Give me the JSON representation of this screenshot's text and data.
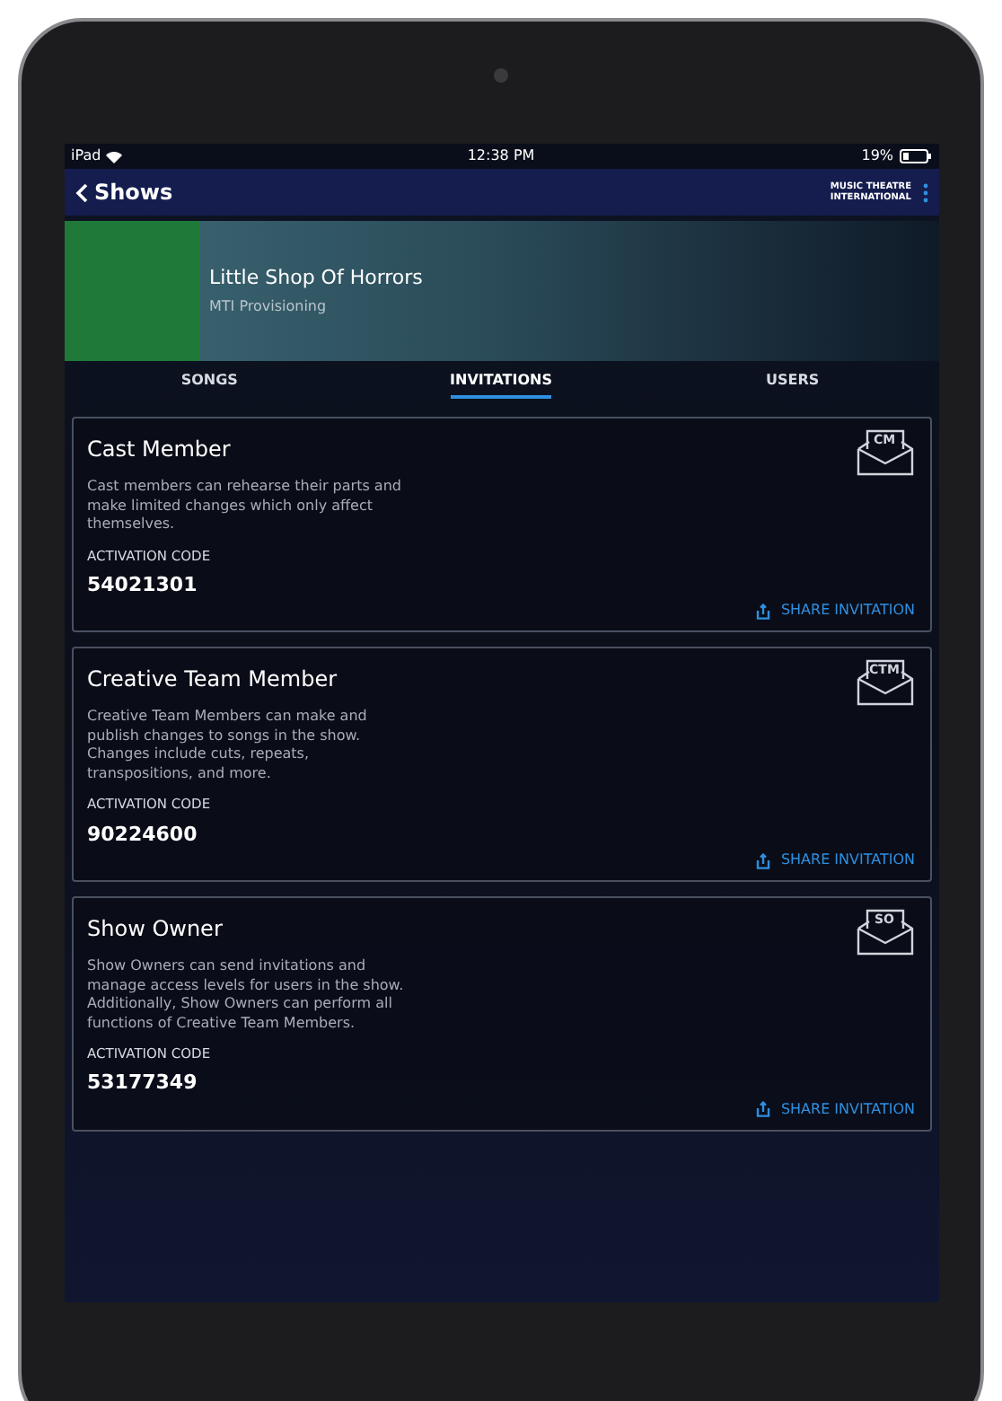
{
  "status_bar": {
    "device": "iPad",
    "time": "12:38 PM",
    "battery": "19%"
  },
  "nav": {
    "back": "Shows",
    "brand_line1": "MUSIC THEATRE",
    "brand_line2": "INTERNATIONAL"
  },
  "show": {
    "title": "Little Shop Of Horrors",
    "subtitle": "MTI Provisioning"
  },
  "tabs": [
    {
      "label": "SONGS",
      "selected": false
    },
    {
      "label": "INVITATIONS",
      "selected": true
    },
    {
      "label": "USERS",
      "selected": false
    }
  ],
  "invitations": [
    {
      "title": "Cast Member",
      "badge": "CM",
      "description": "Cast members can rehearse their parts and make limited changes which only affect themselves.",
      "code_label": "ACTIVATION CODE",
      "code": "54021301",
      "share": "SHARE INVITATION"
    },
    {
      "title": "Creative Team Member",
      "badge": "CTM",
      "description": "Creative Team Members can make and publish changes to songs in the show. Changes include cuts, repeats, transpositions, and more.",
      "code_label": "ACTIVATION CODE",
      "code": "90224600",
      "share": "SHARE INVITATION"
    },
    {
      "title": "Show Owner",
      "badge": "SO",
      "description": "Show Owners can send invitations and manage access levels for users in the show. Additionally, Show Owners can perform all functions of Creative Team Members.",
      "code_label": "ACTIVATION CODE",
      "code": "53177349",
      "share": "SHARE INVITATION"
    }
  ]
}
